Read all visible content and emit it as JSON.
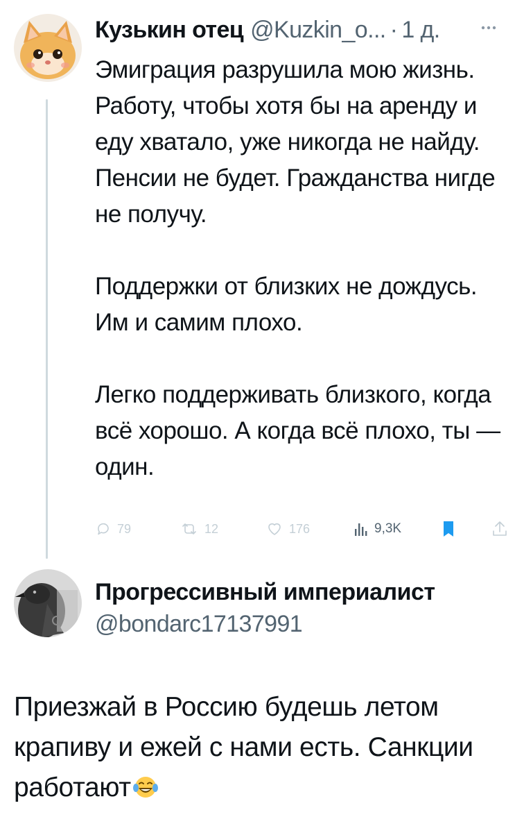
{
  "tweet": {
    "author": {
      "name": "Кузькин отец",
      "handle": "@Kuzkin_o...",
      "separator": "·",
      "time": "1 д."
    },
    "paragraphs": [
      "Эмиграция разрушила мою жизнь. Работу, чтобы хотя бы на аренду и еду хватало, уже никогда не найду. Пенсии не будет. Гражданства нигде не получу.",
      "Поддержки от близких не дождусь. Им и самим плохо.",
      "Легко поддерживать близкого, когда всё хорошо. А когда всё плохо, ты — один."
    ],
    "actions": {
      "replies": "79",
      "retweets": "12",
      "likes": "176",
      "views": "9,3K"
    },
    "icons": {
      "avatar": "kitten-avatar-icon",
      "more": "more-icon",
      "reply": "reply-icon",
      "retweet": "retweet-icon",
      "like": "heart-icon",
      "views": "views-icon",
      "bookmark": "bookmark-icon",
      "share": "share-icon"
    },
    "colors": {
      "bookmark": "#1d9bf0",
      "muted": "#536471",
      "faded": "#c4cfd6",
      "thread_line": "#cfd9de"
    }
  },
  "reply": {
    "author": {
      "name": "Прогрессивный империалист",
      "handle": "@bondarc17137991"
    },
    "text": "Приезжай в Россию будешь летом крапиву и ежей с нами есть. Санкции работают",
    "emoji": "joy-emoji"
  }
}
